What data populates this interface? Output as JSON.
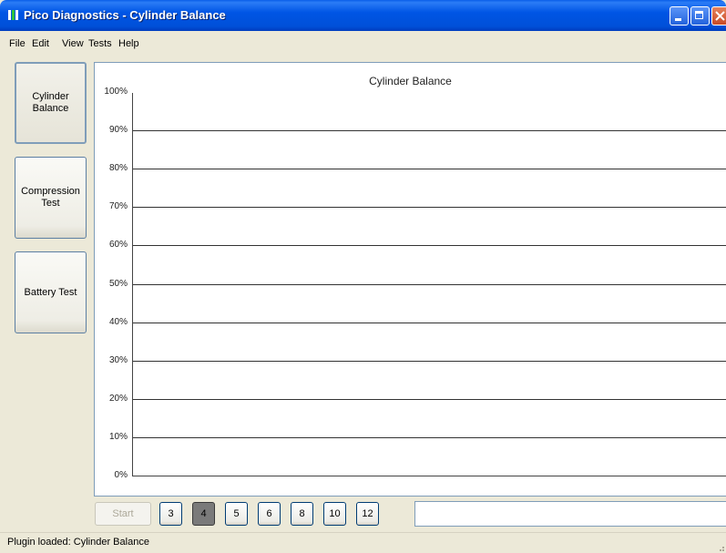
{
  "window": {
    "title": "Pico Diagnostics - Cylinder Balance",
    "controls": [
      "minimize",
      "maximize",
      "close"
    ]
  },
  "menu": {
    "items": [
      "File",
      "Edit",
      "View",
      "Tests",
      "Help"
    ]
  },
  "tests": {
    "items": [
      {
        "line1": "Cylinder",
        "line2": "Balance",
        "active": true
      },
      {
        "line1": "Compression",
        "line2": "Test",
        "active": false
      },
      {
        "line1": "Battery Test",
        "line2": "",
        "active": false
      }
    ]
  },
  "chart_data": {
    "type": "bar",
    "title": "Cylinder Balance",
    "ylim": [
      0,
      100
    ],
    "yticks": [
      "0%",
      "10%",
      "20%",
      "30%",
      "40%",
      "50%",
      "60%",
      "70%",
      "80%",
      "90%",
      "100%"
    ],
    "grid": true,
    "categories": [],
    "values": []
  },
  "controls": {
    "start_label": "Start",
    "start_enabled": false,
    "cylinders": [
      "3",
      "4",
      "5",
      "6",
      "8",
      "10",
      "12"
    ],
    "selected_cylinders": "4",
    "text_value": ""
  },
  "status": {
    "text": "Plugin loaded: Cylinder Balance"
  },
  "colors": {
    "titlebar": "#0055e5",
    "selected_cylinder": "#7a7a7a"
  }
}
